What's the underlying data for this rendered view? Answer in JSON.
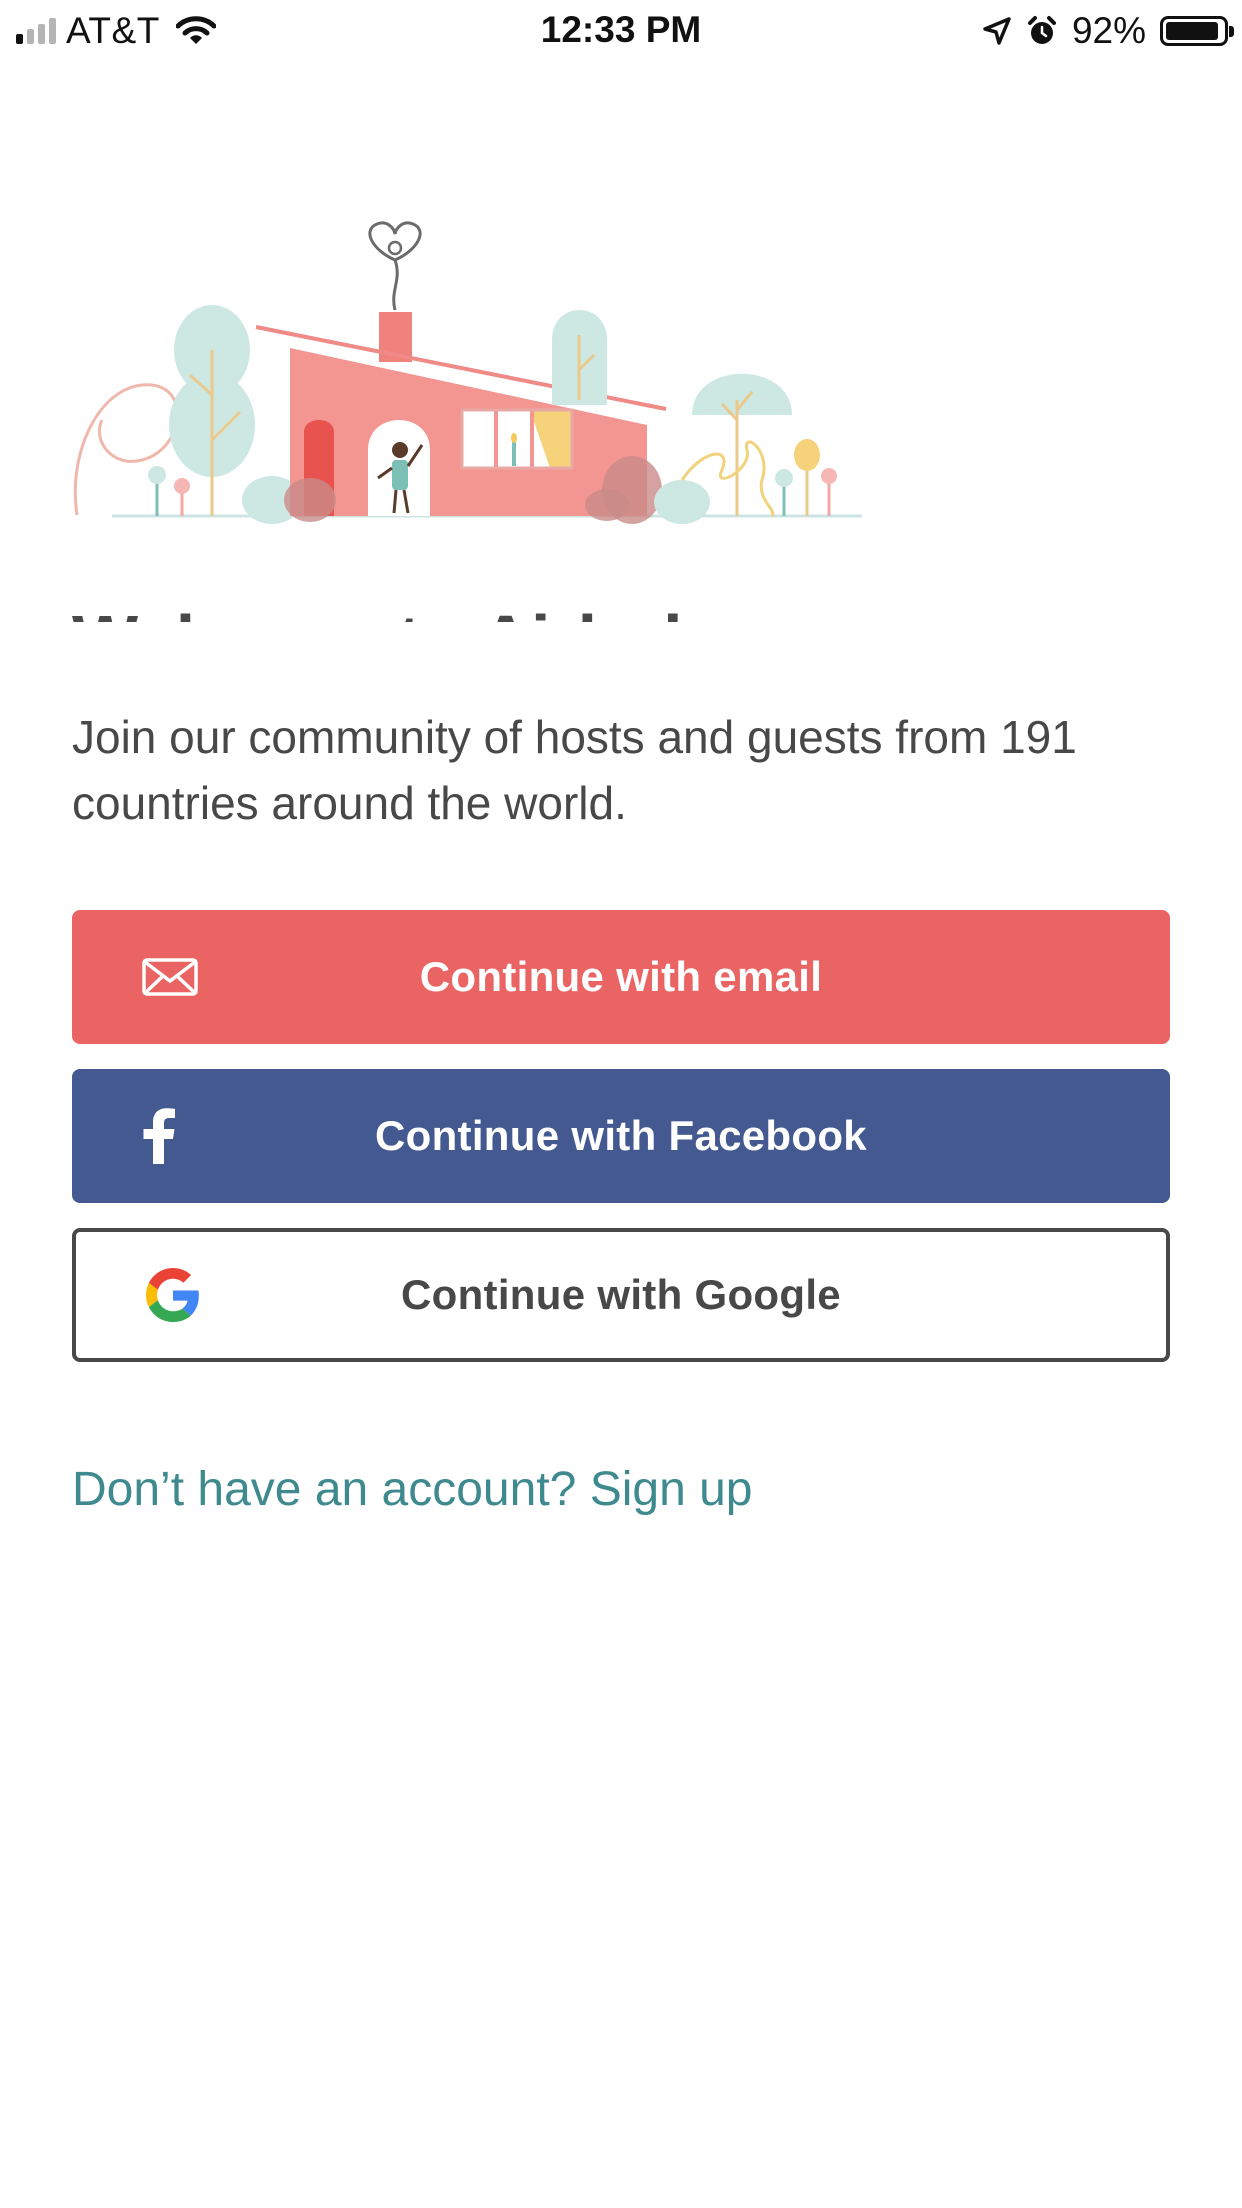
{
  "status_bar": {
    "carrier": "AT&T",
    "time": "12:33 PM",
    "battery_percent": "92%",
    "battery_level": 0.92,
    "signal_bars_filled": 1,
    "signal_bars_total": 4,
    "icons": [
      "signal-icon",
      "wifi-icon",
      "location-arrow-icon",
      "alarm-icon",
      "battery-icon"
    ]
  },
  "welcome": {
    "title": "Welcome to Airbnb",
    "subtitle": "Join our community of hosts and guests from 191 countries around the world."
  },
  "buttons": {
    "email": {
      "label": "Continue with email",
      "icon": "envelope-icon",
      "color": "#eb6464"
    },
    "facebook": {
      "label": "Continue with Facebook",
      "icon": "facebook-icon",
      "color": "#435990"
    },
    "google": {
      "label": "Continue with Google",
      "icon": "google-icon",
      "border_color": "#484848"
    }
  },
  "signup": {
    "label": "Don’t have an account? Sign up",
    "color": "#3f8a8f"
  }
}
